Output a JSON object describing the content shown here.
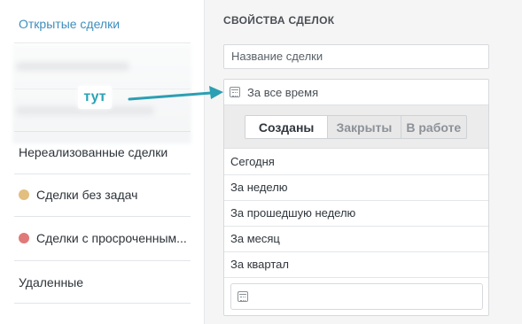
{
  "sidebar": {
    "active_item": "Открытые сделки",
    "items": [
      {
        "label": "Нереализованные сделки",
        "dot": ""
      },
      {
        "label": "Сделки без задач",
        "dot": "#e2bf7f"
      },
      {
        "label": "Сделки с просроченным...",
        "dot": "#e07a78"
      },
      {
        "label": "Удаленные",
        "dot": ""
      }
    ]
  },
  "annotation": {
    "label": "тут",
    "color": "#2aa3b5"
  },
  "panel": {
    "title": "СВОЙСТВА СДЕЛОК",
    "name_placeholder": "Название сделки",
    "period": {
      "icon": "calendar-icon",
      "selected": "За все время",
      "tabs": [
        {
          "label": "Созданы",
          "active": true
        },
        {
          "label": "Закрыты",
          "active": false
        },
        {
          "label": "В работе",
          "active": false
        }
      ],
      "options": [
        "Сегодня",
        "За неделю",
        "За прошедшую неделю",
        "За месяц",
        "За квартал"
      ],
      "range_icon": "calendar-icon"
    }
  },
  "colors": {
    "accent": "#3d8fbd",
    "arrow": "#2b9fb3"
  }
}
